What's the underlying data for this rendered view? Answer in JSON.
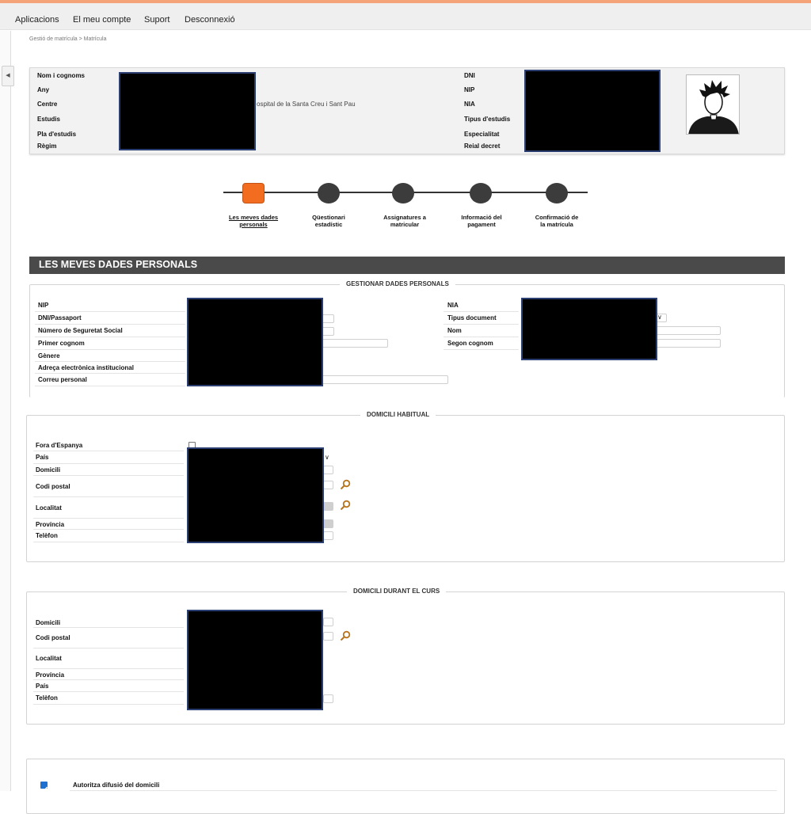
{
  "menu": {
    "apps": "Aplicacions",
    "account": "El meu compte",
    "support": "Suport",
    "logout": "Desconnexió"
  },
  "breadcrumb": "Gestió de matrícula > Matrícula",
  "header": {
    "name_label": "Nom i cognoms",
    "year_label": "Any",
    "centre_label": "Centre",
    "centre_value": "ospital de la Santa Creu i Sant Pau",
    "studies_label": "Estudis",
    "plan_label": "Pla d'estudis",
    "regime_label": "Règim",
    "dni_label": "DNI",
    "nip_label": "NIP",
    "nia_label": "NIA",
    "study_type_label": "Tipus d'estudis",
    "specialty_label": "Especialitat",
    "decree_label": "Reial decret"
  },
  "steps": [
    {
      "line1": "Les meves dades",
      "line2": "personals"
    },
    {
      "line1": "Qüestionari",
      "line2": "estadístic"
    },
    {
      "line1": "Assignatures a",
      "line2": "matricular"
    },
    {
      "line1": "Informació del",
      "line2": "pagament"
    },
    {
      "line1": "Confirmació de",
      "line2": "la matrícula"
    }
  ],
  "section_title": "LES MEVES DADES PERSONALS",
  "personal": {
    "legend": "GESTIONAR DADES PERSONALS",
    "nip": "NIP",
    "dni": "DNI/Passaport",
    "ss": "Número de Seguretat Social",
    "surname1": "Primer cognom",
    "gender": "Gènere",
    "inst_email": "Adreça electrònica institucional",
    "email": "Correu personal",
    "nia": "NIA",
    "doc_type": "Tipus document",
    "name": "Nom",
    "surname2": "Segon cognom"
  },
  "home": {
    "legend": "DOMICILI HABITUAL",
    "abroad": "Fora d'Espanya",
    "country": "País",
    "address": "Domicili",
    "postal": "Codi postal",
    "locality": "Localitat",
    "province": "Província",
    "phone": "Telèfon"
  },
  "course": {
    "legend": "DOMICILI DURANT EL CURS",
    "address": "Domicili",
    "postal": "Codi postal",
    "locality": "Localitat",
    "province": "Província",
    "country": "País",
    "phone": "Telèfon"
  },
  "authorize": {
    "label": "Autoritza difusió del domicili",
    "checked": true
  },
  "colors": {
    "accent": "#f26d1f",
    "section_bar": "#4a4a4a",
    "redaction_border": "#2b3f73"
  }
}
